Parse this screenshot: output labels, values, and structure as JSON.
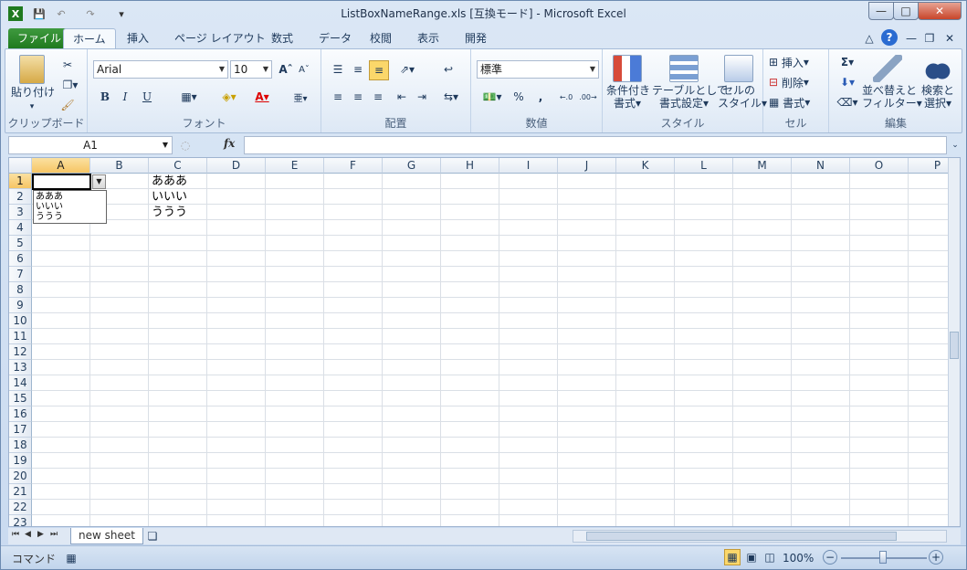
{
  "window": {
    "title": "ListBoxNameRange.xls  [互換モード] - Microsoft Excel"
  },
  "tabs": [
    "ファイル",
    "ホーム",
    "挿入",
    "ページ レイアウト",
    "数式",
    "データ",
    "校閲",
    "表示",
    "開発"
  ],
  "ribbon": {
    "clipboard": {
      "paste": "貼り付け",
      "label": "クリップボード"
    },
    "font": {
      "name": "Arial",
      "size": "10",
      "label": "フォント",
      "bold": "B",
      "italic": "I",
      "underline": "U"
    },
    "alignment": {
      "label": "配置"
    },
    "number": {
      "format": "標準",
      "percent": "%",
      "comma": ",",
      "label": "数値"
    },
    "styles": {
      "cond1": "条件付き",
      "cond2": "書式",
      "table1": "テーブルとして",
      "table2": "書式設定",
      "cell1": "セルの",
      "cell2": "スタイル",
      "label": "スタイル"
    },
    "cells": {
      "insert": "挿入",
      "delete": "削除",
      "format": "書式",
      "label": "セル"
    },
    "editing": {
      "sort1": "並べ替えと",
      "sort2": "フィルター",
      "find1": "検索と",
      "find2": "選択",
      "label": "編集"
    }
  },
  "formula": {
    "namebox": "A1",
    "fx": "fx",
    "value": ""
  },
  "columns": [
    "A",
    "B",
    "C",
    "D",
    "E",
    "F",
    "G",
    "H",
    "I",
    "J",
    "K",
    "L",
    "M",
    "N",
    "O",
    "P"
  ],
  "rows": [
    "1",
    "2",
    "3",
    "4",
    "5",
    "6",
    "7",
    "8",
    "9",
    "10",
    "11",
    "12",
    "13",
    "14",
    "15",
    "16",
    "17",
    "18",
    "19",
    "20",
    "21",
    "22",
    "23"
  ],
  "cells": {
    "C1": "あああ",
    "C2": "いいい",
    "C3": "ううう"
  },
  "listbox": {
    "items": [
      "あああ",
      "いいい",
      "ううう"
    ]
  },
  "sheettabs": {
    "active": "new sheet"
  },
  "status": {
    "mode": "コマンド",
    "zoom": "100%"
  },
  "colors": {
    "file_tab": "#2a862a",
    "selection_header": "#f6c564"
  }
}
